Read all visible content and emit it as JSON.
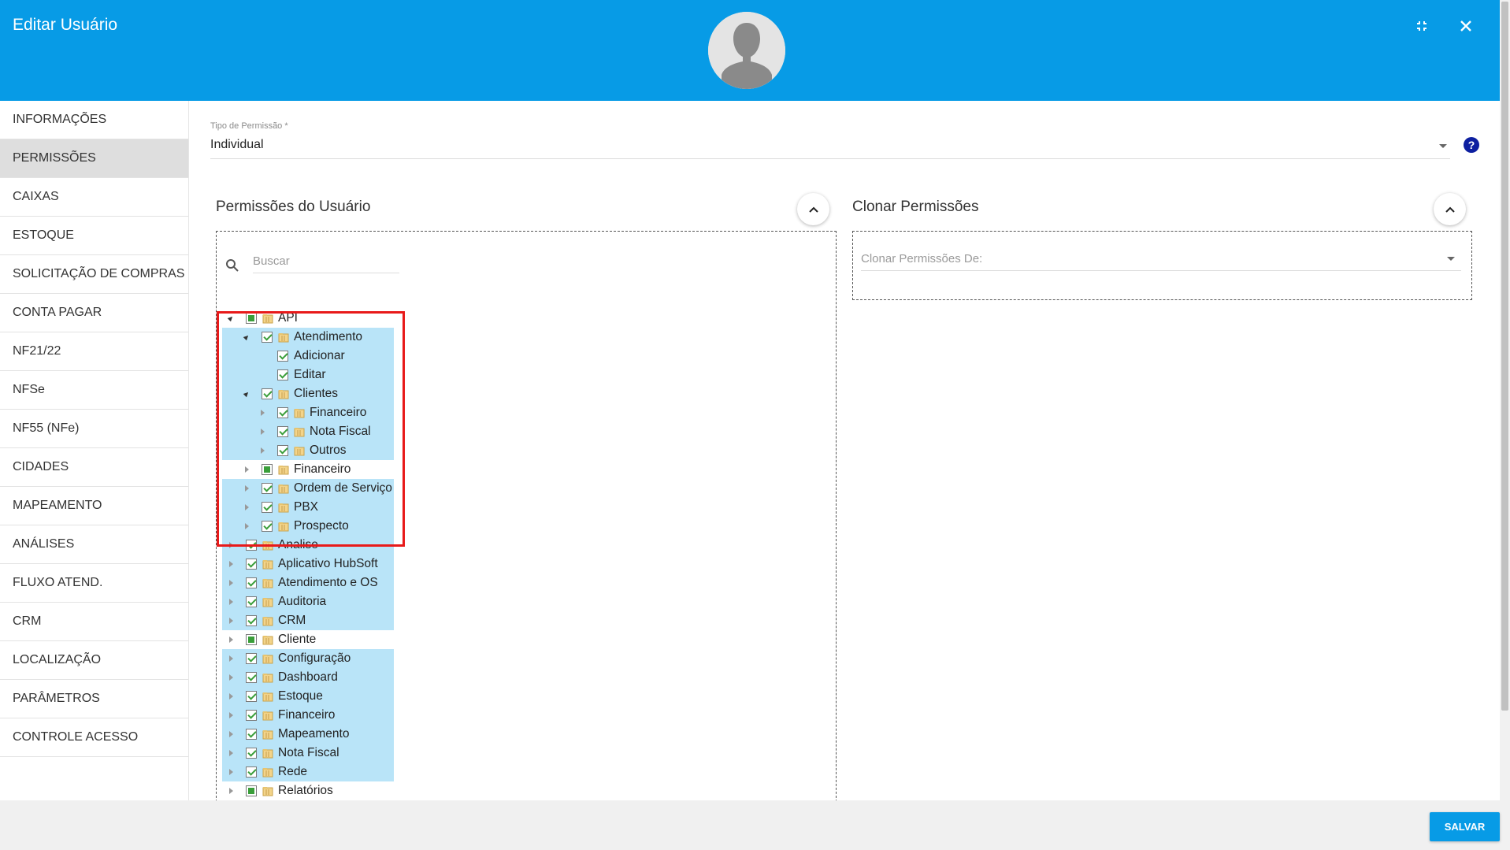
{
  "header": {
    "title": "Editar Usuário"
  },
  "sidebar": {
    "items": [
      {
        "label": "INFORMAÇÕES",
        "active": false
      },
      {
        "label": "PERMISSÕES",
        "active": true
      },
      {
        "label": "CAIXAS",
        "active": false
      },
      {
        "label": "ESTOQUE",
        "active": false
      },
      {
        "label": "SOLICITAÇÃO DE COMPRAS",
        "active": false
      },
      {
        "label": "CONTA PAGAR",
        "active": false
      },
      {
        "label": "NF21/22",
        "active": false
      },
      {
        "label": "NFSe",
        "active": false
      },
      {
        "label": "NF55 (NFe)",
        "active": false
      },
      {
        "label": "CIDADES",
        "active": false
      },
      {
        "label": "MAPEAMENTO",
        "active": false
      },
      {
        "label": "ANÁLISES",
        "active": false
      },
      {
        "label": "FLUXO ATEND.",
        "active": false
      },
      {
        "label": "CRM",
        "active": false
      },
      {
        "label": "LOCALIZAÇÃO",
        "active": false
      },
      {
        "label": "PARÂMETROS",
        "active": false
      },
      {
        "label": "CONTROLE ACESSO",
        "active": false
      }
    ]
  },
  "permission_type": {
    "label": "Tipo de Permissão *",
    "value": "Individual",
    "help": "?"
  },
  "user_permissions": {
    "title": "Permissões do Usuário",
    "search_placeholder": "Buscar",
    "tree": [
      {
        "level": 0,
        "toggle": "expanded",
        "check": "partial",
        "folder": true,
        "label": "API",
        "hl": false
      },
      {
        "level": 1,
        "toggle": "expanded",
        "check": "checked",
        "folder": true,
        "label": "Atendimento",
        "hl": true
      },
      {
        "level": 2,
        "toggle": "none",
        "check": "checked",
        "folder": false,
        "label": "Adicionar",
        "hl": true
      },
      {
        "level": 2,
        "toggle": "none",
        "check": "checked",
        "folder": false,
        "label": "Editar",
        "hl": true
      },
      {
        "level": 1,
        "toggle": "expanded",
        "check": "checked",
        "folder": true,
        "label": "Clientes",
        "hl": true
      },
      {
        "level": 2,
        "toggle": "collapsed",
        "check": "checked",
        "folder": true,
        "label": "Financeiro",
        "hl": true
      },
      {
        "level": 2,
        "toggle": "collapsed",
        "check": "checked",
        "folder": true,
        "label": "Nota Fiscal",
        "hl": true
      },
      {
        "level": 2,
        "toggle": "collapsed",
        "check": "checked",
        "folder": true,
        "label": "Outros",
        "hl": true
      },
      {
        "level": 1,
        "toggle": "collapsed",
        "check": "partial",
        "folder": true,
        "label": "Financeiro",
        "hl": false
      },
      {
        "level": 1,
        "toggle": "collapsed",
        "check": "checked",
        "folder": true,
        "label": "Ordem de Serviço",
        "hl": true
      },
      {
        "level": 1,
        "toggle": "collapsed",
        "check": "checked",
        "folder": true,
        "label": "PBX",
        "hl": true
      },
      {
        "level": 1,
        "toggle": "collapsed",
        "check": "checked",
        "folder": true,
        "label": "Prospecto",
        "hl": true
      },
      {
        "level": 0,
        "toggle": "collapsed",
        "check": "checked",
        "folder": true,
        "label": "Analise",
        "hl": true
      },
      {
        "level": 0,
        "toggle": "collapsed",
        "check": "checked",
        "folder": true,
        "label": "Aplicativo HubSoft",
        "hl": true
      },
      {
        "level": 0,
        "toggle": "collapsed",
        "check": "checked",
        "folder": true,
        "label": "Atendimento e OS",
        "hl": true
      },
      {
        "level": 0,
        "toggle": "collapsed",
        "check": "checked",
        "folder": true,
        "label": "Auditoria",
        "hl": true
      },
      {
        "level": 0,
        "toggle": "collapsed",
        "check": "checked",
        "folder": true,
        "label": "CRM",
        "hl": true
      },
      {
        "level": 0,
        "toggle": "collapsed",
        "check": "partial",
        "folder": true,
        "label": "Cliente",
        "hl": false
      },
      {
        "level": 0,
        "toggle": "collapsed",
        "check": "checked",
        "folder": true,
        "label": "Configuração",
        "hl": true
      },
      {
        "level": 0,
        "toggle": "collapsed",
        "check": "checked",
        "folder": true,
        "label": "Dashboard",
        "hl": true
      },
      {
        "level": 0,
        "toggle": "collapsed",
        "check": "checked",
        "folder": true,
        "label": "Estoque",
        "hl": true
      },
      {
        "level": 0,
        "toggle": "collapsed",
        "check": "checked",
        "folder": true,
        "label": "Financeiro",
        "hl": true
      },
      {
        "level": 0,
        "toggle": "collapsed",
        "check": "checked",
        "folder": true,
        "label": "Mapeamento",
        "hl": true
      },
      {
        "level": 0,
        "toggle": "collapsed",
        "check": "checked",
        "folder": true,
        "label": "Nota Fiscal",
        "hl": true
      },
      {
        "level": 0,
        "toggle": "collapsed",
        "check": "checked",
        "folder": true,
        "label": "Rede",
        "hl": true
      },
      {
        "level": 0,
        "toggle": "collapsed",
        "check": "partial",
        "folder": true,
        "label": "Relatórios",
        "hl": false
      }
    ]
  },
  "clone_permissions": {
    "title": "Clonar Permissões",
    "placeholder": "Clonar Permissões De:"
  },
  "footer": {
    "save_label": "SALVAR"
  },
  "colors": {
    "primary": "#079be6",
    "highlight_row": "#b9e4f8",
    "annotation_box": "#e81a1a",
    "help_icon": "#0d1fa0"
  }
}
